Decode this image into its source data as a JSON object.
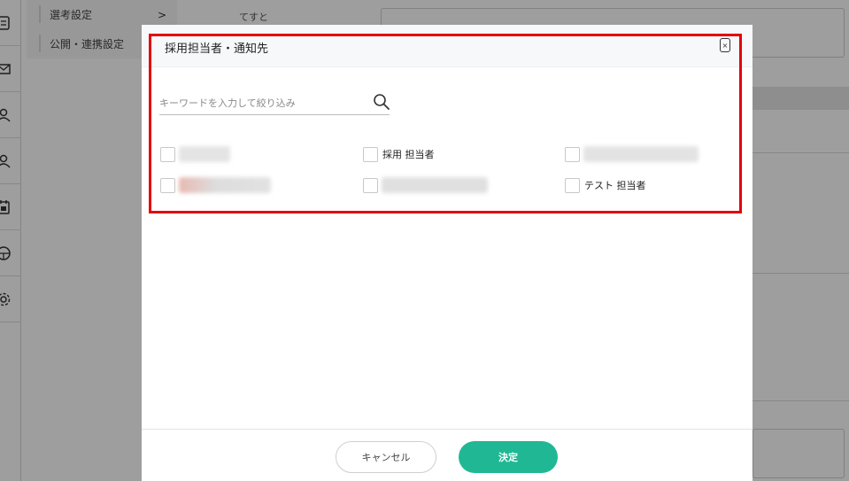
{
  "sidebar": {
    "icons": [
      "document-icon",
      "mail-icon",
      "person-icon",
      "person-search-icon",
      "calendar-icon",
      "org-icon",
      "settings-icon"
    ]
  },
  "subnav": {
    "items": [
      {
        "label": "選考設定",
        "chevron": ">"
      },
      {
        "label": "公開・連携設定"
      }
    ]
  },
  "background": {
    "field_label": "てすと"
  },
  "modal": {
    "title": "採用担当者・通知先",
    "close_label": "×",
    "search": {
      "placeholder": "キーワードを入力して絞り込み",
      "value": ""
    },
    "options": [
      {
        "label": "",
        "redacted": true,
        "blur_color": "#d9d9d9"
      },
      {
        "label": "採用 担当者",
        "redacted": false
      },
      {
        "label": "",
        "redacted": true,
        "blur_color": "#dcdcdc"
      },
      {
        "label": "",
        "redacted": true,
        "blur_color": "#e2b8b3"
      },
      {
        "label": "",
        "redacted": true,
        "blur_color": "#d5d5d5"
      },
      {
        "label": "テスト 担当者",
        "redacted": false
      }
    ],
    "footer": {
      "cancel_label": "キャンセル",
      "ok_label": "決定"
    }
  },
  "colors": {
    "accent": "#20b894",
    "highlight": "#e3000f"
  }
}
